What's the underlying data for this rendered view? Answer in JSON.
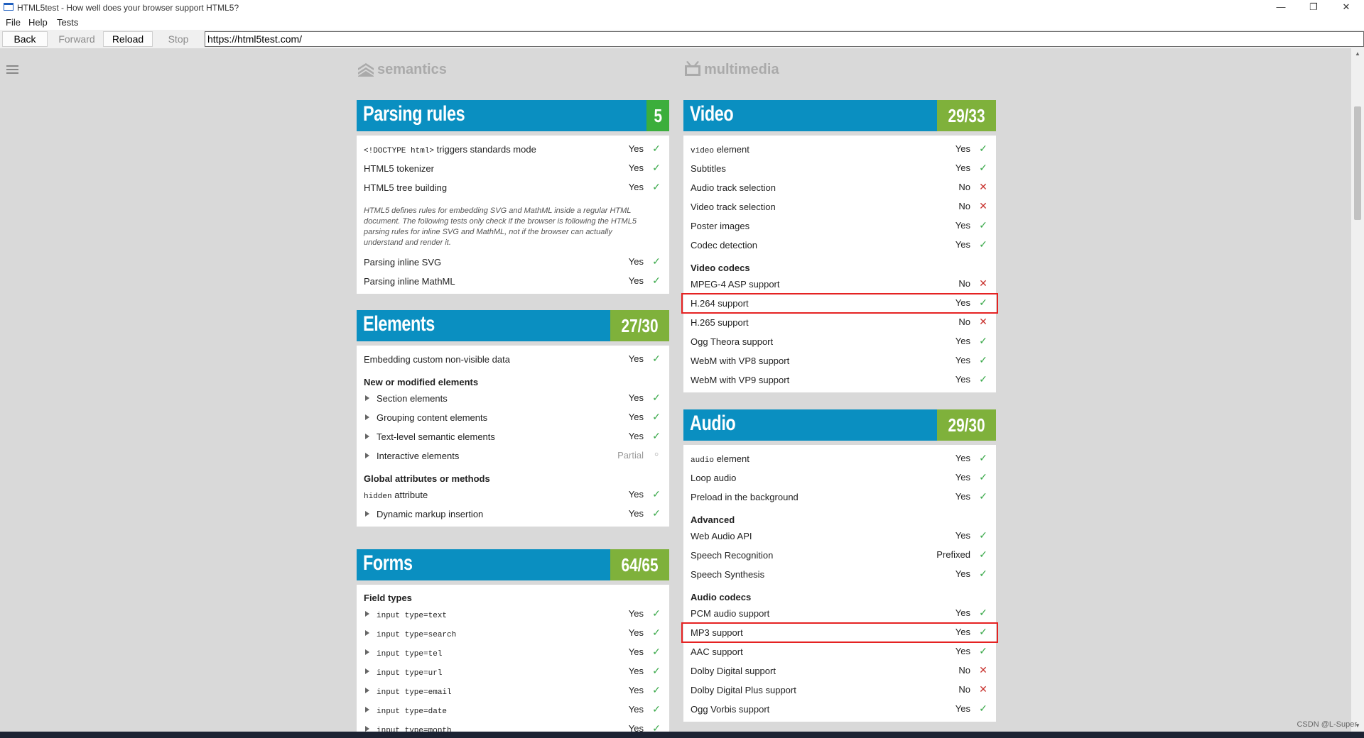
{
  "window": {
    "title": "HTML5test - How well does your browser support HTML5?",
    "minimize": "—",
    "maximize": "❐",
    "close": "✕"
  },
  "menu": [
    "File",
    "Help",
    "Tests"
  ],
  "nav": {
    "back": "Back",
    "forward": "Forward",
    "reload": "Reload",
    "stop": "Stop",
    "url": "https://html5test.com/"
  },
  "left": {
    "category": "semantics",
    "parsing": {
      "title": "Parsing rules",
      "score": "5",
      "rows1": [
        {
          "code": "<!DOCTYPE html>",
          "label": " triggers standards mode",
          "result": "Yes",
          "status": "yes"
        },
        {
          "label": "HTML5 tokenizer",
          "result": "Yes",
          "status": "yes"
        },
        {
          "label": "HTML5 tree building",
          "result": "Yes",
          "status": "yes"
        }
      ],
      "note": "HTML5 defines rules for embedding SVG and MathML inside a regular HTML document. The following tests only check if the browser is following the HTML5 parsing rules for inline SVG and MathML, not if the browser can actually understand and render it.",
      "rows2": [
        {
          "label": "Parsing inline SVG",
          "result": "Yes",
          "status": "yes"
        },
        {
          "label": "Parsing inline MathML",
          "result": "Yes",
          "status": "yes"
        }
      ]
    },
    "elements": {
      "title": "Elements",
      "score": "27/30",
      "rows1": [
        {
          "label": "Embedding custom non-visible data",
          "result": "Yes",
          "status": "yes"
        }
      ],
      "sub1": "New or modified elements",
      "rows2": [
        {
          "label": "Section elements",
          "result": "Yes",
          "status": "yes"
        },
        {
          "label": "Grouping content elements",
          "result": "Yes",
          "status": "yes"
        },
        {
          "label": "Text-level semantic elements",
          "result": "Yes",
          "status": "yes"
        },
        {
          "label": "Interactive elements",
          "result": "Partial",
          "status": "partial"
        }
      ],
      "sub2": "Global attributes or methods",
      "rows3": [
        {
          "code": "hidden",
          "label": " attribute",
          "result": "Yes",
          "status": "yes"
        },
        {
          "label": "Dynamic markup insertion",
          "result": "Yes",
          "status": "yes"
        }
      ]
    },
    "forms": {
      "title": "Forms",
      "score": "64/65",
      "sub1": "Field types",
      "rows": [
        {
          "code": "input type=text",
          "result": "Yes",
          "status": "yes"
        },
        {
          "code": "input type=search",
          "result": "Yes",
          "status": "yes"
        },
        {
          "code": "input type=tel",
          "result": "Yes",
          "status": "yes"
        },
        {
          "code": "input type=url",
          "result": "Yes",
          "status": "yes"
        },
        {
          "code": "input type=email",
          "result": "Yes",
          "status": "yes"
        },
        {
          "code": "input type=date",
          "result": "Yes",
          "status": "yes"
        },
        {
          "code": "input type=month",
          "result": "Yes",
          "status": "yes"
        }
      ]
    }
  },
  "right": {
    "category": "multimedia",
    "video": {
      "title": "Video",
      "score": "29/33",
      "rows1": [
        {
          "code": "video",
          "label": " element",
          "result": "Yes",
          "status": "yes"
        },
        {
          "label": "Subtitles",
          "result": "Yes",
          "status": "yes"
        },
        {
          "label": "Audio track selection",
          "result": "No",
          "status": "no"
        },
        {
          "label": "Video track selection",
          "result": "No",
          "status": "no"
        },
        {
          "label": "Poster images",
          "result": "Yes",
          "status": "yes"
        },
        {
          "label": "Codec detection",
          "result": "Yes",
          "status": "yes"
        }
      ],
      "sub1": "Video codecs",
      "rows2": [
        {
          "label": "MPEG-4 ASP support",
          "result": "No",
          "status": "no"
        },
        {
          "label": "H.264 support",
          "result": "Yes",
          "status": "yes",
          "highlight": true
        },
        {
          "label": "H.265 support",
          "result": "No",
          "status": "no"
        },
        {
          "label": "Ogg Theora support",
          "result": "Yes",
          "status": "yes"
        },
        {
          "label": "WebM with VP8 support",
          "result": "Yes",
          "status": "yes"
        },
        {
          "label": "WebM with VP9 support",
          "result": "Yes",
          "status": "yes"
        }
      ]
    },
    "audio": {
      "title": "Audio",
      "score": "29/30",
      "rows1": [
        {
          "code": "audio",
          "label": " element",
          "result": "Yes",
          "status": "yes"
        },
        {
          "label": "Loop audio",
          "result": "Yes",
          "status": "yes"
        },
        {
          "label": "Preload in the background",
          "result": "Yes",
          "status": "yes"
        }
      ],
      "sub1": "Advanced",
      "rows2": [
        {
          "label": "Web Audio API",
          "result": "Yes",
          "status": "yes"
        },
        {
          "label": "Speech Recognition",
          "result": "Prefixed",
          "status": "yes"
        },
        {
          "label": "Speech Synthesis",
          "result": "Yes",
          "status": "yes"
        }
      ],
      "sub2": "Audio codecs",
      "rows3": [
        {
          "label": "PCM audio support",
          "result": "Yes",
          "status": "yes"
        },
        {
          "label": "MP3 support",
          "result": "Yes",
          "status": "yes",
          "highlight": true
        },
        {
          "label": "AAC support",
          "result": "Yes",
          "status": "yes"
        },
        {
          "label": "Dolby Digital support",
          "result": "No",
          "status": "no"
        },
        {
          "label": "Dolby Digital Plus support",
          "result": "No",
          "status": "no"
        },
        {
          "label": "Ogg Vorbis support",
          "result": "Yes",
          "status": "yes"
        }
      ]
    }
  },
  "watermark": "CSDN @L-Super",
  "colors": {
    "header": "#0a8fc1",
    "score_partial": "#7fb13b",
    "score_full": "#3cae3c",
    "yes": "#3aa94a",
    "no": "#c8322e",
    "highlight": "#e52222"
  }
}
